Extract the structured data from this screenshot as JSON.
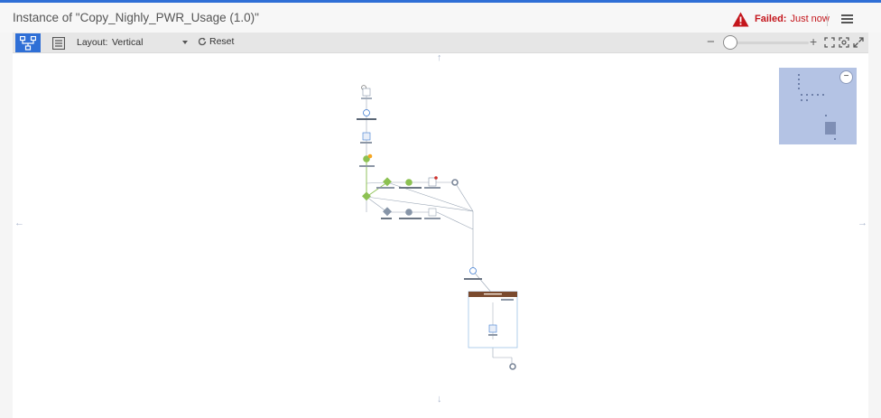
{
  "header": {
    "title": "Instance of \"Copy_Nighly_PWR_Usage (1.0)\"",
    "status_label": "Failed:",
    "status_time": "Just now",
    "status_color": "#c4161c"
  },
  "toolbar": {
    "diagram_view_icon": "flow-diagram-icon",
    "list_view_icon": "list-view-icon",
    "layout_label": "Layout:",
    "layout_value": "Vertical",
    "reset_label": "Reset",
    "zoom_minus": "−",
    "zoom_plus": "+",
    "fit_icon": "fit-to-screen-icon",
    "zoom_selection_icon": "zoom-selection-icon",
    "fullscreen_icon": "fullscreen-icon",
    "accent": "#2f6fd6"
  },
  "overview": {
    "close_label": "−"
  },
  "nav": {
    "up": "↑",
    "down": "↓",
    "left": "←",
    "right": "→"
  }
}
